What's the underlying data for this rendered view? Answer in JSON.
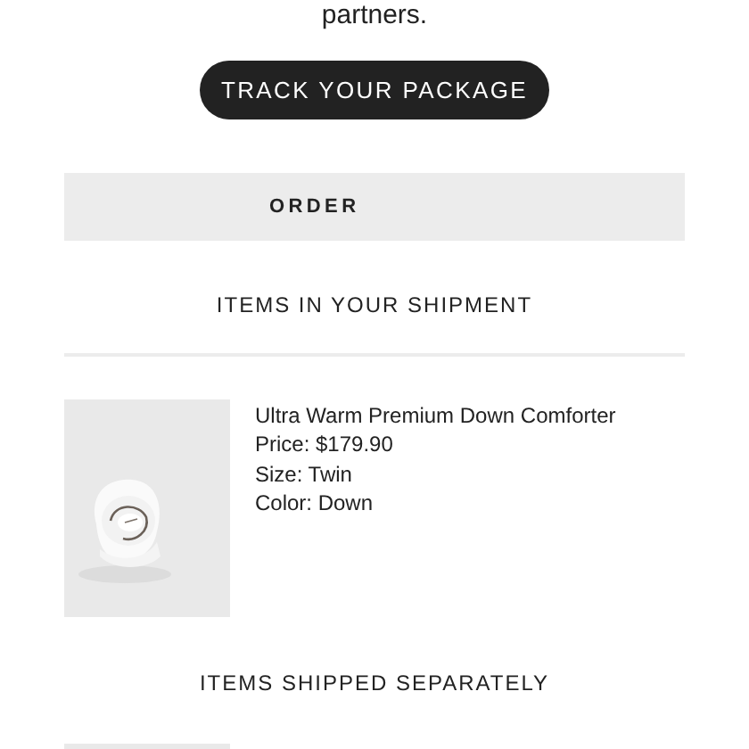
{
  "intro": {
    "text": "partners."
  },
  "track_button": {
    "label": "TRACK YOUR PACKAGE"
  },
  "order_bar": {
    "label": "ORDER"
  },
  "sections": [
    {
      "heading": "ITEMS IN YOUR SHIPMENT",
      "divider": true,
      "items": [
        {
          "kind": "picture",
          "name": "Ultra Warm Premium Down Comforter",
          "price": "Price: $179.90",
          "size": "Size: Twin",
          "variant": "Color: Down"
        }
      ]
    },
    {
      "heading": "ITEMS SHIPPED SEPARATELY",
      "divider": false
    }
  ]
}
